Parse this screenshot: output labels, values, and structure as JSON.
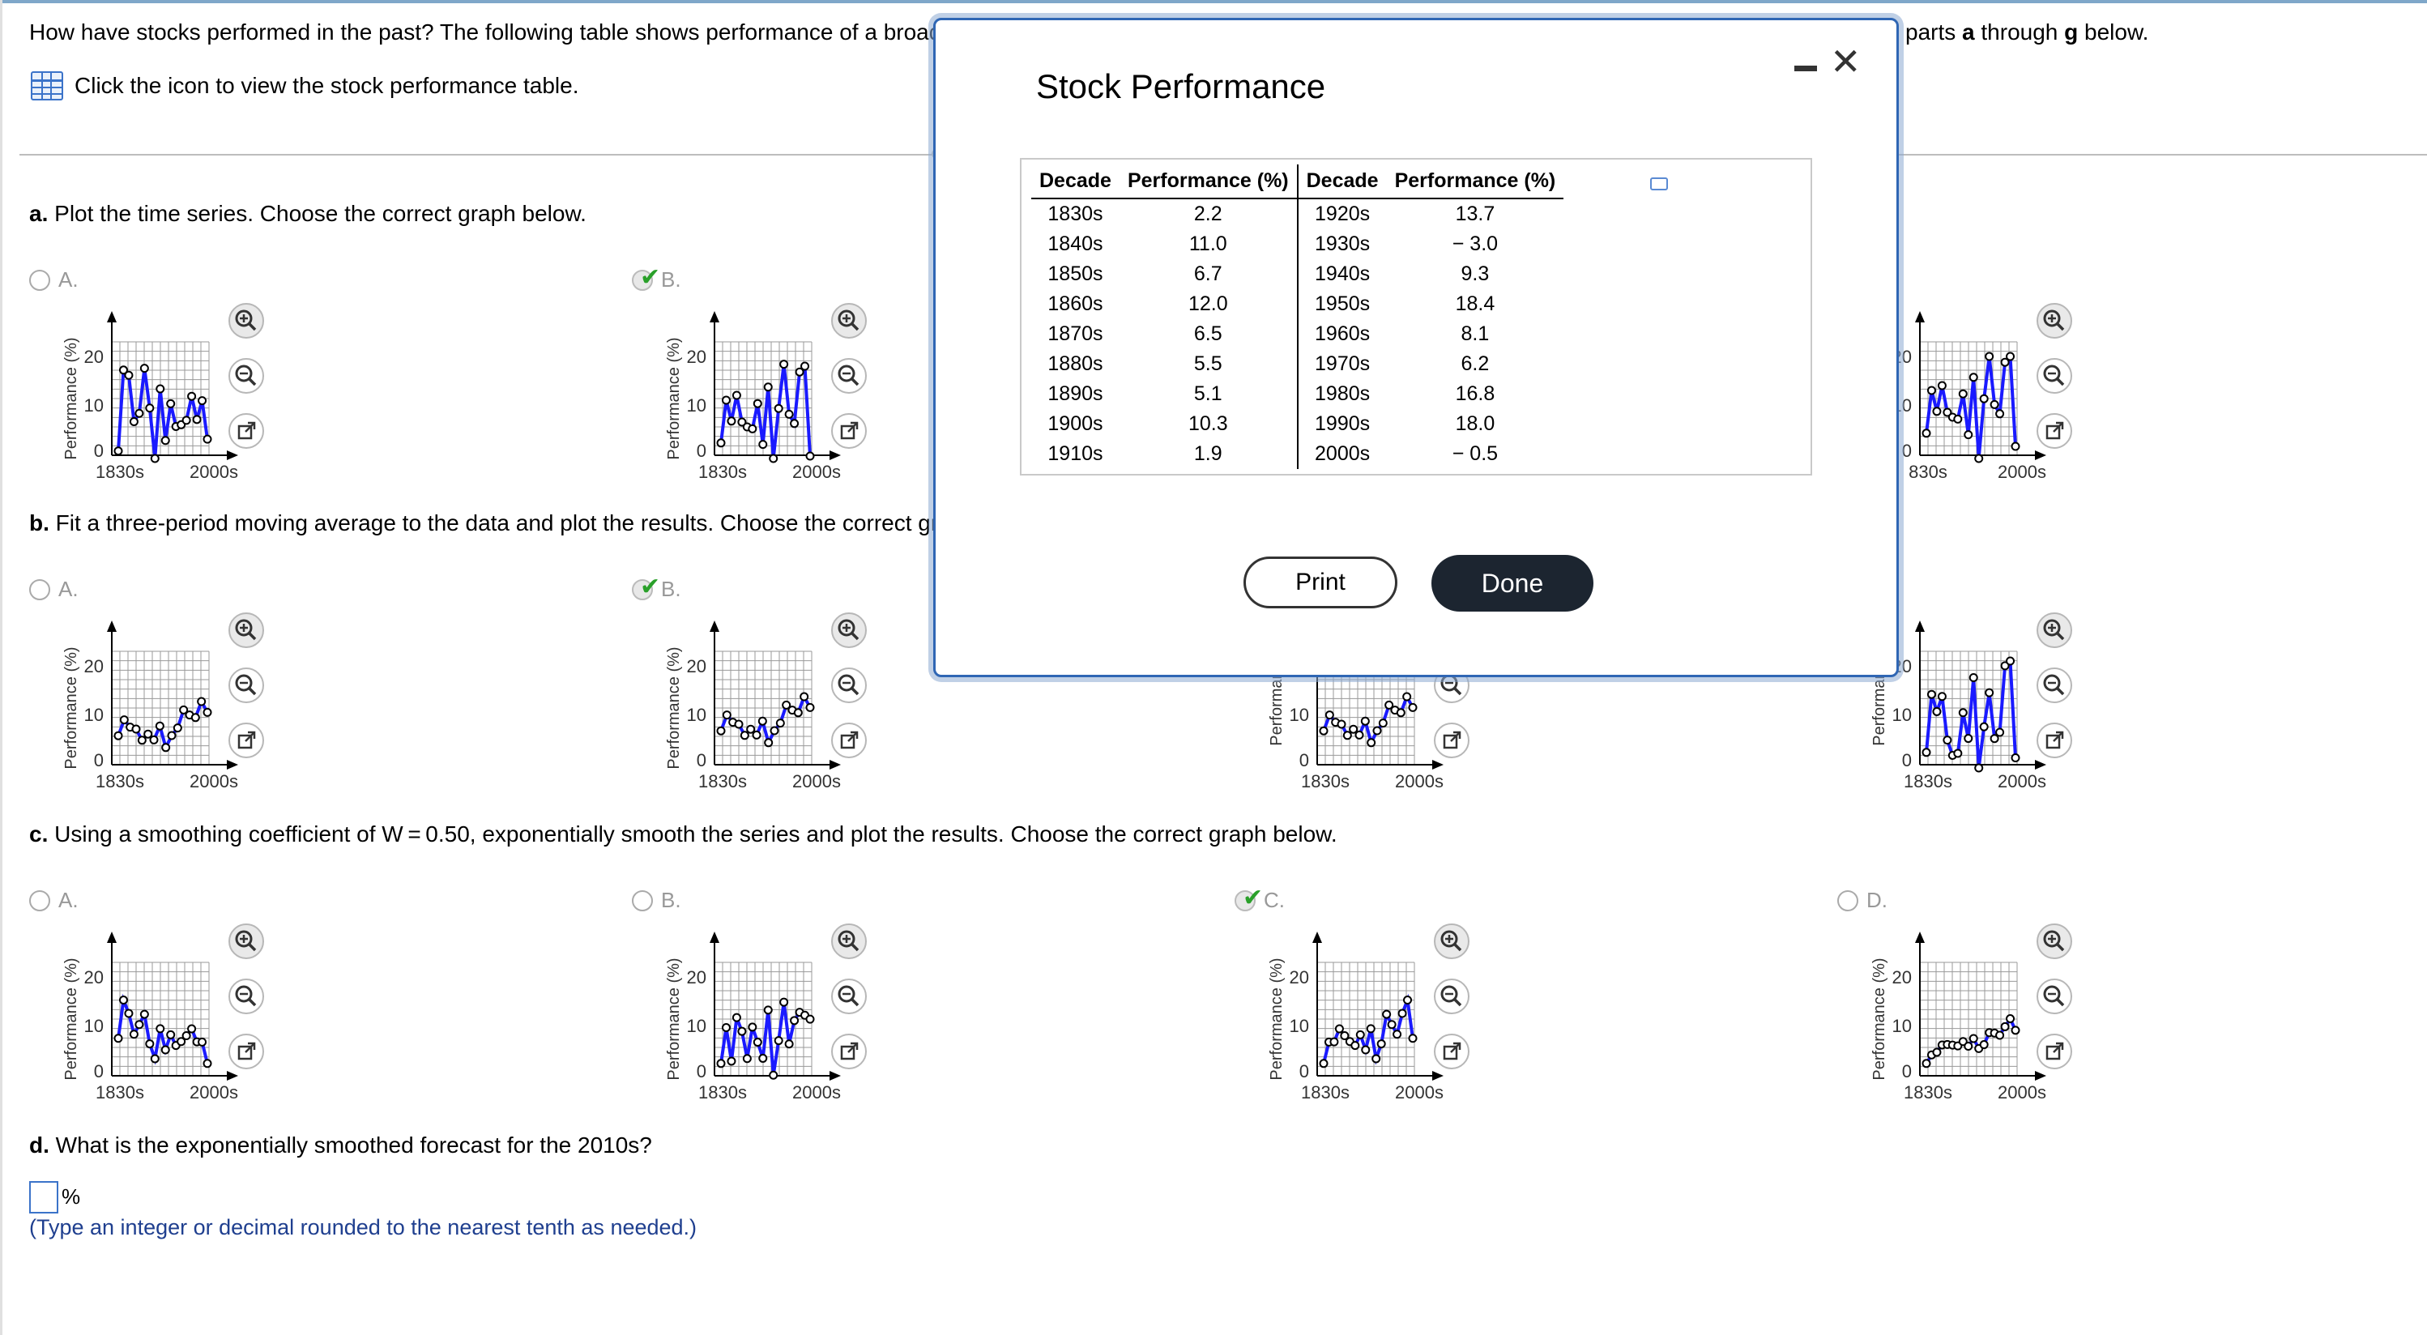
{
  "intro": {
    "text": "How have stocks performed in the past? The following table shows performance of a broad meas",
    "text_right_prefix": "parts ",
    "text_right_a": "a",
    "text_right_mid": " through ",
    "text_right_g": "g",
    "text_right_suffix": " below."
  },
  "table_link": {
    "label": "Click the icon to view the stock performance table.",
    "icon": "table-grid-icon"
  },
  "questions": {
    "a": {
      "letter": "a.",
      "text": " Plot the time series. Choose the correct graph below."
    },
    "b": {
      "letter": "b.",
      "text": " Fit a three-period moving average to the data and plot the results. Choose the correct graph be"
    },
    "c": {
      "letter": "c.",
      "text": " Using a smoothing coefficient of W = 0.50, exponentially smooth the series and plot the results. Choose the correct graph below."
    },
    "d": {
      "letter": "d.",
      "text": " What is the exponentially smoothed forecast for the 2010s?"
    }
  },
  "options": {
    "A": "A.",
    "B": "B.",
    "C": "C.",
    "D": "D."
  },
  "graph_labels": {
    "ylabel": "Performance (%)",
    "ylabel_trunc": "Performan",
    "xlabel": "Decade",
    "tick_1830": "1830s",
    "tick_1830_trunc": "830s",
    "tick_2000": "2000s",
    "y20": "20",
    "y10": "10",
    "y0": "0"
  },
  "answer": {
    "value": "",
    "unit": "%",
    "hint": "(Type an integer or decimal rounded to the nearest tenth as needed.)"
  },
  "modal": {
    "title": "Stock Performance",
    "headers": [
      "Decade",
      "Performance (%)",
      "Decade",
      "Performance (%)"
    ],
    "rows": [
      [
        "1830s",
        "2.2",
        "1920s",
        "13.7"
      ],
      [
        "1840s",
        "11.0",
        "1930s",
        "− 3.0"
      ],
      [
        "1850s",
        "6.7",
        "1940s",
        "9.3"
      ],
      [
        "1860s",
        "12.0",
        "1950s",
        "18.4"
      ],
      [
        "1870s",
        "6.5",
        "1960s",
        "8.1"
      ],
      [
        "1880s",
        "5.5",
        "1970s",
        "6.2"
      ],
      [
        "1890s",
        "5.1",
        "1980s",
        "16.8"
      ],
      [
        "1900s",
        "10.3",
        "1990s",
        "18.0"
      ],
      [
        "1910s",
        "1.9",
        "2000s",
        "− 0.5"
      ]
    ],
    "print_label": "Print",
    "done_label": "Done"
  },
  "colors": {
    "series": "#1a1aff",
    "accent": "#2f66b4",
    "check": "#2aa02a"
  }
}
